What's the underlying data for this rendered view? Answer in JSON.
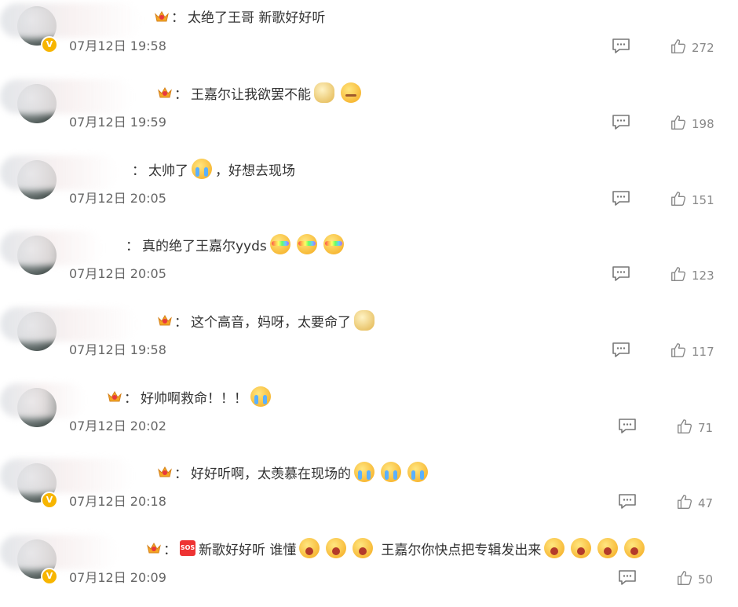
{
  "comments": [
    {
      "text": "太绝了王哥 新歌好好听",
      "emojis": [],
      "time": "07月12日 19:58",
      "likes": "272",
      "vip": true,
      "crown": true
    },
    {
      "text": "王嘉尔让我欲罢不能",
      "emojis": [
        "doge-emoji",
        "smirk-emoji"
      ],
      "time": "07月12日 19:59",
      "likes": "198",
      "vip": false,
      "crown": true
    },
    {
      "text": "太帅了",
      "emojis": [
        "cry-emoji"
      ],
      "suffix": "，好想去现场",
      "time": "07月12日 20:05",
      "likes": "151",
      "vip": false,
      "crown": false
    },
    {
      "text": "真的绝了王嘉尔yyds",
      "emojis": [
        "rainbow-emoji",
        "rainbow-emoji",
        "rainbow-emoji"
      ],
      "time": "07月12日 20:05",
      "likes": "123",
      "vip": false,
      "crown": false
    },
    {
      "text": "这个高音，妈呀，太要命了",
      "emojis": [
        "doge-emoji"
      ],
      "time": "07月12日 19:58",
      "likes": "117",
      "vip": false,
      "crown": true
    },
    {
      "text": "好帅啊救命！！！",
      "emojis": [
        "cry-emoji"
      ],
      "time": "07月12日 20:02",
      "likes": "71",
      "vip": false,
      "crown": true
    },
    {
      "text": "好好听啊，太羡慕在现场的",
      "emojis": [
        "cry-emoji",
        "cry-emoji",
        "cry-emoji"
      ],
      "time": "07月12日 20:18",
      "likes": "47",
      "vip": true,
      "crown": true
    },
    {
      "text": "新歌好好听 谁懂",
      "emojis": [
        "scream-emoji",
        "scream-emoji",
        "scream-emoji"
      ],
      "middle": "王嘉尔你快点把专辑发出来",
      "emojis2": [
        "scream-emoji",
        "scream-emoji",
        "scream-emoji",
        "scream-emoji"
      ],
      "time": "07月12日 20:09",
      "likes": "50",
      "vip": true,
      "crown": true,
      "sos": "SOS"
    }
  ]
}
